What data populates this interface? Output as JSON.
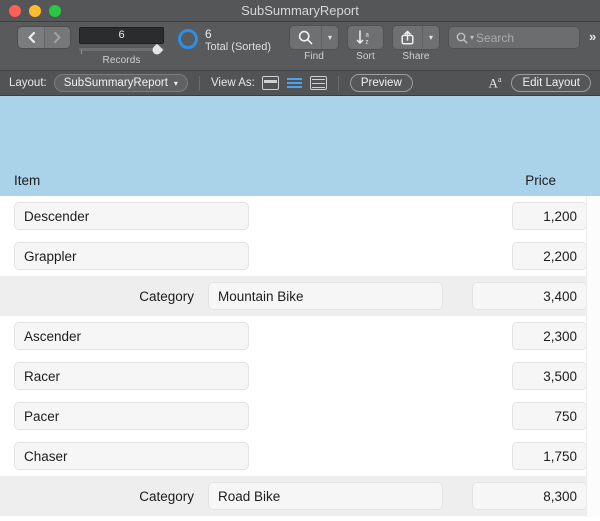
{
  "window": {
    "title": "SubSummaryReport",
    "traffic_lights": [
      "close",
      "minimize",
      "maximize"
    ]
  },
  "toolbar": {
    "nav_prev_icon": "chevron-left-icon",
    "nav_next_icon": "chevron-right-icon",
    "record_number": "6",
    "records_caption": "Records",
    "total_count": "6",
    "total_label": "Total (Sorted)",
    "find_label": "Find",
    "find_icon": "search-icon",
    "sort_label": "Sort",
    "sort_icon": "sort-az-icon",
    "share_label": "Share",
    "share_icon": "share-icon",
    "search_placeholder": "Search",
    "search_value": "",
    "overflow_icon": "double-chevron-right-icon"
  },
  "layoutbar": {
    "layout_label": "Layout:",
    "layout_value": "SubSummaryReport",
    "view_as_label": "View As:",
    "view_form": "form-view-icon",
    "view_list": "list-view-icon",
    "view_table": "table-view-icon",
    "active_view": "list",
    "preview_label": "Preview",
    "text_size_icon": "text-size-icon",
    "edit_layout_label": "Edit Layout"
  },
  "report": {
    "header_band_color": "#aad2e8",
    "column_item": "Item",
    "column_price": "Price",
    "summary_label": "Category",
    "rows": [
      {
        "type": "record",
        "item": "Descender",
        "price": "1,200"
      },
      {
        "type": "record",
        "item": "Grappler",
        "price": "2,200"
      },
      {
        "type": "summary",
        "item": "Mountain Bike",
        "price": "3,400"
      },
      {
        "type": "record",
        "item": "Ascender",
        "price": "2,300"
      },
      {
        "type": "record",
        "item": "Racer",
        "price": "3,500"
      },
      {
        "type": "record",
        "item": "Pacer",
        "price": "750"
      },
      {
        "type": "record",
        "item": "Chaser",
        "price": "1,750"
      },
      {
        "type": "summary",
        "item": "Road Bike",
        "price": "8,300"
      }
    ]
  }
}
